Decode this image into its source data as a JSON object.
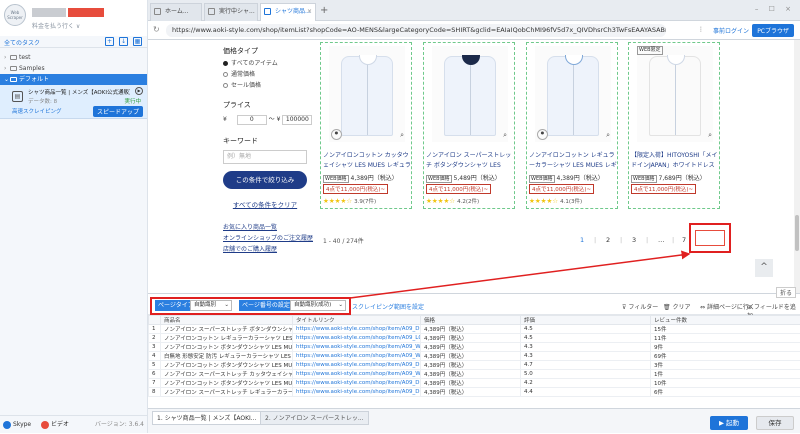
{
  "sidebar": {
    "logo_text": "Web Scraper",
    "user_sub": "料金を払う行く ∨",
    "all_tasks": "全てのタスク",
    "tree": [
      {
        "label": "test",
        "sel": false
      },
      {
        "label": "Samples",
        "sel": false
      },
      {
        "label": "デフォルト",
        "sel": true
      }
    ],
    "task": {
      "title": "シャツ商品一覧 | メンズ【AOKI公式通販】",
      "sub": "データ数: 8",
      "status": "実行中",
      "cloud": "高速スクレイピング",
      "speed_btn": "スピードアップ"
    },
    "footer": {
      "skype": "Skype",
      "video": "ビデオ",
      "version": "バージョン: 3.6.4"
    }
  },
  "browser": {
    "tabs": [
      {
        "label": "ホーム...",
        "active": false
      },
      {
        "label": "実行中シャ...",
        "active": false
      },
      {
        "label": "シャツ商品...",
        "active": true
      }
    ],
    "url": "https://www.aoki-style.com/shop/itemList?shopCode=AO-MENS&largeCategoryCode=SHIRT&gclid=EAIaIQobChMI96fV5d7x_QIVDhsrCh3TwFsEAAYASABEgI...",
    "login": "事前ログイン",
    "pc_browser": "PCブラウザ"
  },
  "filter": {
    "price_type_title": "価格タイプ",
    "radios": [
      {
        "label": "すべてのアイテム",
        "on": true
      },
      {
        "label": "通常価格",
        "on": false
      },
      {
        "label": "セール価格",
        "on": false
      }
    ],
    "price_title": "プライス",
    "yen": "¥",
    "price_min": "0",
    "tilde": "〜",
    "price_max": "100000",
    "keyword_title": "キーワード",
    "keyword_placeholder": "例）無地",
    "search_btn": "この条件で絞り込み",
    "clear": "すべての条件をクリア",
    "links": [
      "お気に入り商品一覧",
      "オンラインショップのご注文履歴",
      "店舗でのご購入履歴"
    ]
  },
  "products": [
    {
      "name": "ノンアイロンコットン カッタウェイシャツ LES MUES レギュラーフィット",
      "web": "WEB価格",
      "price": "4,389円（税込）",
      "p4": "4点で11,000円(税込)~",
      "stars": "★★★★☆",
      "count": "3.9(7件)",
      "variant": "blue",
      "badge": ""
    },
    {
      "name": "ノンアイロン スーパーストレッチ ボタンダウンシャツ LES MUES レギュラーフィット",
      "web": "WEB価格",
      "price": "5,489円（税込）",
      "p4": "4点で11,000円(税込)~",
      "stars": "★★★★☆",
      "count": "4.2(2件)",
      "variant": "blue",
      "badge": ""
    },
    {
      "name": "ノンアイロンコットン レギュラーカラーシャツ LES MUES レギュラーフィット",
      "web": "WEB価格",
      "price": "4,389円（税込）",
      "p4": "4点で11,000円(税込)~",
      "stars": "★★★★☆",
      "count": "4.1(3件)",
      "variant": "blue",
      "badge": ""
    },
    {
      "name": "【限定入荷】HITOYOSHI「メイドインJAPAN」ホワイトドレスコクション ボタンダウンシャツ レギュラーフィット",
      "web": "WEB価格",
      "price": "7,689円（税込）",
      "p4": "4点で11,000円(税込)~",
      "stars": "",
      "count": "",
      "variant": "white",
      "badge": "WEB限定"
    }
  ],
  "pager": {
    "count": "1 - 40 / 274件",
    "pages": [
      "1",
      "2",
      "3",
      "…",
      "7"
    ],
    "current": "1"
  },
  "toolbar": {
    "page_type": "ページタイプ",
    "page_type_val": "自動識別",
    "page_num": "ページ番号の設定",
    "page_num_val": "自動識別(成功)",
    "scrape_range": "スクレイピング範囲を設定",
    "filter": "フィルター",
    "clear": "クリア",
    "detail": "詳細ページに行く",
    "add_field": "フィールドを追加",
    "fold": "折る"
  },
  "table": {
    "headers": [
      "",
      "商品名",
      "タイトルリンク",
      "価格",
      "評価",
      "レビュー件数"
    ],
    "rows": [
      [
        "1",
        "ノンアイロン スーパーストレッチ ボタンダウンシャツ LES...",
        "https://www.aoki-style.com/shop/item/A09_DEW601-...",
        "4,389円（税込）",
        "4.5",
        "15件"
      ],
      [
        "2",
        "ノンアイロンコットン レギュラーカラーシャツ LES MUES...",
        "https://www.aoki-style.com/shop/item/A09_LCSR23-...",
        "4,389円（税込）",
        "4.5",
        "11件"
      ],
      [
        "3",
        "ノンアイロンコットン ボタンダウンシャツ LES MUES...",
        "https://www.aoki-style.com/shop/item/A09_WN2923-...",
        "4,389円（税込）",
        "4.3",
        "9件"
      ],
      [
        "4",
        "白無地 形態安定 防汚 レギュラーカラーシャツ LES MUES...",
        "https://www.aoki-style.com/shop/item/A09_WN2923-...",
        "4,389円（税込）",
        "4.3",
        "69件"
      ],
      [
        "5",
        "ノンアイロンコットン ボタンダウンシャツ LES MUES...",
        "https://www.aoki-style.com/shop/item/A09_DED523-...",
        "4,389円（税込）",
        "4.7",
        "3件"
      ],
      [
        "6",
        "ノンアイロン スーパーストレッチ カッタウェイシャツ LES...",
        "https://www.aoki-style.com/shop/item/A09_WN3223-...",
        "4,389円（税込）",
        "5.0",
        "1件"
      ],
      [
        "7",
        "ノンアイロンコットン ボタンダウンシャツ LES MUES...",
        "https://www.aoki-style.com/shop/item/A09_DEW600-...",
        "4,389円（税込）",
        "4.2",
        "10件"
      ],
      [
        "8",
        "ノンアイロン スーパーストレッチ レギュラーカラーシャツ...",
        "https://www.aoki-style.com/shop/item/A09_DEW602-...",
        "4,389円（税込）",
        "4.4",
        "6件"
      ]
    ]
  },
  "bottom": {
    "tab1": "1. シャツ商品一覧 | メンズ【AOKI...",
    "tab2": "2. ノンアイロン スーパーストレッ...",
    "start": "起動",
    "save": "保存"
  },
  "colors": {
    "accent": "#1e74d9",
    "highlight": "#e02020",
    "navy": "#1f3c88"
  }
}
